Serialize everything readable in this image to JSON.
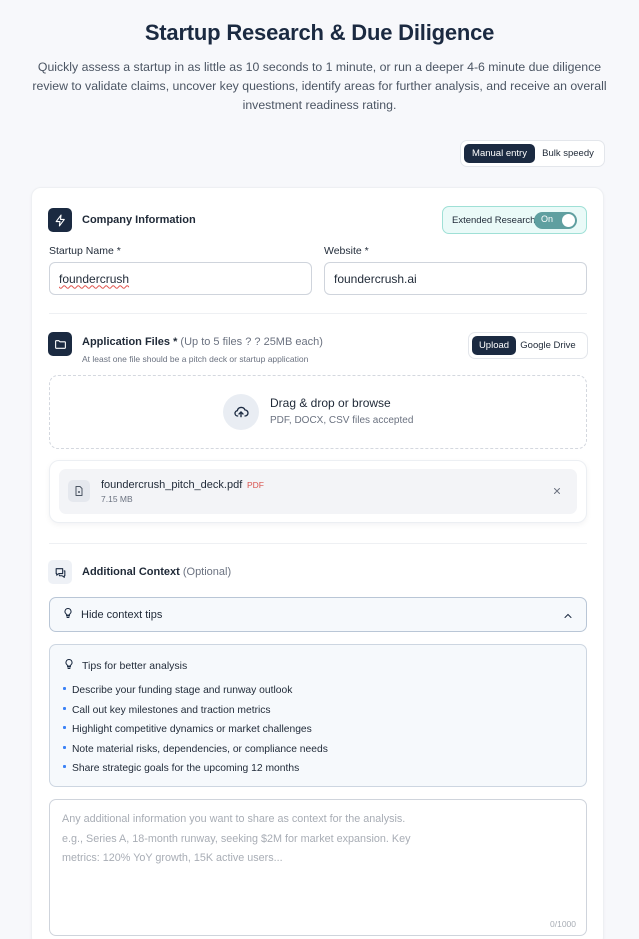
{
  "page": {
    "title": "Startup Research & Due Diligence",
    "subtitle": "Quickly assess a startup in as little as 10 seconds to 1 minute, or run a deeper 4-6 minute due diligence review to validate claims, uncover key questions, identify areas for further analysis, and receive an overall investment readiness rating."
  },
  "mode_toggle": {
    "options": [
      "Manual entry",
      "Bulk speedy"
    ],
    "selected": "Manual entry"
  },
  "company": {
    "title": "Company Information",
    "extended_research_label": "Extended Research",
    "extended_research_state": "On",
    "startup_name_label": "Startup Name *",
    "startup_name_value": "foundercrush",
    "website_label": "Website *",
    "website_value": "foundercrush.ai"
  },
  "files": {
    "title": "Application Files *",
    "limits": "(Up to 5 files ? ? 25MB each)",
    "hint": "At least one file should be a pitch deck or startup application",
    "source_options": [
      "Upload",
      "Google Drive"
    ],
    "source_selected": "Upload",
    "dropzone_title": "Drag & drop or browse",
    "dropzone_sub": "PDF, DOCX, CSV files accepted",
    "items": [
      {
        "name": "foundercrush_pitch_deck.pdf",
        "type": "PDF",
        "size": "7.15 MB"
      }
    ]
  },
  "context": {
    "title": "Additional Context",
    "optional": "(Optional)",
    "tips_toggle_label": "Hide context tips",
    "tips_title": "Tips for better analysis",
    "tips": [
      "Describe your funding stage and runway outlook",
      "Call out key milestones and traction metrics",
      "Highlight competitive dynamics or market challenges",
      "Note material risks, dependencies, or compliance needs",
      "Share strategic goals for the upcoming 12 months"
    ],
    "textarea_placeholder_line1": "Any additional information you want to share as context for the analysis.",
    "textarea_placeholder_line2": "e.g., Series A, 18-month runway, seeking $2M for market expansion. Key",
    "textarea_placeholder_line3": "metrics: 120% YoY growth, 15K active users...",
    "counter": "0/1000"
  },
  "colors": {
    "navy": "#1b2a41",
    "teal_toggle": "#5f9fa0",
    "teal_bg": "#eafaf8",
    "pdf_badge": "#d9534f",
    "bullet": "#3b82f6"
  },
  "icons": [
    "bolt-icon",
    "folder-icon",
    "upload-cloud-icon",
    "file-icon",
    "close-icon",
    "chat-icon",
    "lightbulb-icon",
    "chevron-up-icon"
  ]
}
